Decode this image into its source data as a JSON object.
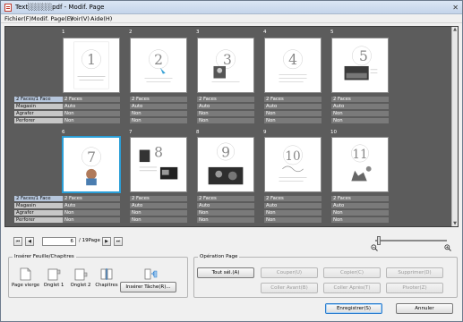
{
  "window": {
    "title": "Text░░░░░pdf - Modif. Page",
    "close_glyph": "✕"
  },
  "menu": [
    {
      "label": "Fichier(F)"
    },
    {
      "label": "Modif. Page(E)"
    },
    {
      "label": "Voir(V)"
    },
    {
      "label": "Aide(H)"
    }
  ],
  "attribute_labels": [
    "2 Faces/1 Face",
    "Magasin",
    "Agrafer",
    "Perforer"
  ],
  "pages": [
    {
      "number": "1",
      "attrs": [
        "2 Faces",
        "Auto",
        "Non",
        "Non"
      ],
      "selected": false
    },
    {
      "number": "2",
      "attrs": [
        "2 Faces",
        "Auto",
        "Non",
        "Non"
      ],
      "selected": false
    },
    {
      "number": "3",
      "attrs": [
        "2 Faces",
        "Auto",
        "Non",
        "Non"
      ],
      "selected": false
    },
    {
      "number": "4",
      "attrs": [
        "2 Faces",
        "Auto",
        "Non",
        "Non"
      ],
      "selected": false
    },
    {
      "number": "5",
      "attrs": [
        "2 Faces",
        "Auto",
        "Non",
        "Non"
      ],
      "selected": false
    },
    {
      "number": "6",
      "attrs": [
        "2 Faces",
        "Auto",
        "Non",
        "Non"
      ],
      "selected": true
    },
    {
      "number": "7",
      "attrs": [
        "2 Faces",
        "Auto",
        "Non",
        "Non"
      ],
      "selected": false
    },
    {
      "number": "8",
      "attrs": [
        "2 Faces",
        "Auto",
        "Non",
        "Non"
      ],
      "selected": false
    },
    {
      "number": "9",
      "attrs": [
        "2 Faces",
        "Auto",
        "Non",
        "Non"
      ],
      "selected": false
    },
    {
      "number": "10",
      "attrs": [
        "2 Faces",
        "Auto",
        "Non",
        "Non"
      ],
      "selected": false
    }
  ],
  "thumbnails": {
    "numbers": [
      "1",
      "2",
      "3",
      "4",
      "5",
      "7",
      "8",
      "9",
      "10",
      "11"
    ]
  },
  "nav": {
    "current_page": "6",
    "total": "/ 19Page",
    "first_glyph": "⏮",
    "prev_glyph": "◀",
    "next_glyph": "▶",
    "last_glyph": "⏭"
  },
  "insert_group": {
    "legend": "Insérer Feuille/Chapitres",
    "tools": [
      {
        "label": "Page vierge",
        "icon": "blank-page-icon"
      },
      {
        "label": "Onglet 1",
        "icon": "tab-1-icon"
      },
      {
        "label": "Onglet 2",
        "icon": "tab-2-icon"
      },
      {
        "label": "Chapitres",
        "icon": "chapters-icon"
      }
    ],
    "insert_task_label": "Insérer Tâche(R)..."
  },
  "operation_group": {
    "legend": "Opération Page",
    "buttons": [
      {
        "label": "Tout sél.(A)",
        "enabled": true
      },
      {
        "label": "Couper(U)",
        "enabled": false
      },
      {
        "label": "Copier(C)",
        "enabled": false
      },
      {
        "label": "Supprimer(D)",
        "enabled": false
      },
      {
        "label": "Coller Avant(B)",
        "enabled": false
      },
      {
        "label": "Coller Après(T)",
        "enabled": false
      },
      {
        "label": "Pivoter(Z)",
        "enabled": false
      }
    ]
  },
  "footer": {
    "save_label": "Enregistrer(S)",
    "cancel_label": "Annuler"
  },
  "zoom": {
    "level_fraction": 0.05
  },
  "colors": {
    "selection": "#2a9fd8",
    "viewer_bg": "#5c5c5c"
  }
}
